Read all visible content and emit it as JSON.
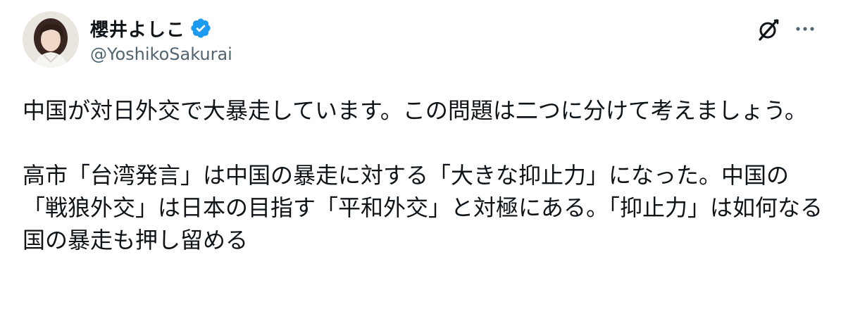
{
  "author": {
    "display_name": "櫻井よしこ",
    "handle": "@YoshikoSakurai"
  },
  "icons": {
    "avatar": "profile-photo",
    "verified": "verified-badge-icon",
    "grok": "grok-icon",
    "more": "more-options-icon"
  },
  "colors": {
    "verified_blue": "#1d9bf0",
    "text_primary": "#0f1419",
    "text_secondary": "#536471"
  },
  "post": {
    "paragraphs": [
      "中国が対日外交で大暴走しています。この問題は二つに分けて考えましょう。",
      "高市「台湾発言」は中国の暴走に対する「大きな抑止力」になった。中国の「戦狼外交」は日本の目指す「平和外交」と対極にある。「抑止力」は如何なる国の暴走も押し留める"
    ]
  }
}
